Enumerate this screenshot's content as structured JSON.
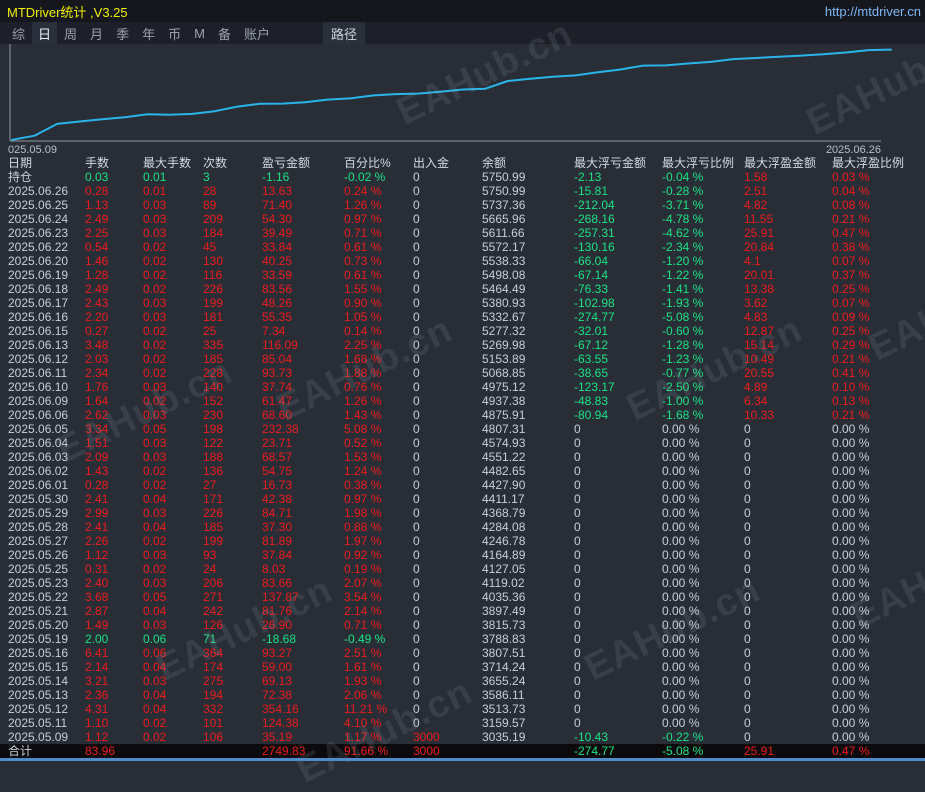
{
  "window": {
    "title": "MTDriver统计 ,V3.25",
    "url": "http://mtdriver.cn"
  },
  "menu": {
    "items": [
      {
        "label": "综",
        "active": false
      },
      {
        "label": "日",
        "active": true
      },
      {
        "label": "周",
        "active": false
      },
      {
        "label": "月",
        "active": false
      },
      {
        "label": "季",
        "active": false
      },
      {
        "label": "年",
        "active": false
      },
      {
        "label": "币",
        "active": false
      },
      {
        "label": "M",
        "active": false
      },
      {
        "label": "备",
        "active": false
      },
      {
        "label": "账户",
        "active": false
      }
    ],
    "path_button": "路径"
  },
  "watermark": {
    "text": "EAHub.cn"
  },
  "colors": {
    "red": "#ee1c1c",
    "green": "#1ce283",
    "text": "#c7cfd8",
    "line": "#29b5ea",
    "title_yellow": "#f0ef00",
    "url_blue": "#7cb8f5"
  },
  "chart_data": {
    "type": "line",
    "title": "账户余额曲线 (equity curve)",
    "x_start_label": "025.05.09",
    "x_end_label": "2025.06.26",
    "ylim": [
      3000,
      5800
    ],
    "line_color": "#29b5ea",
    "grid": false,
    "dates": [
      "2025.05.09",
      "2025.05.11",
      "2025.05.12",
      "2025.05.13",
      "2025.05.14",
      "2025.05.15",
      "2025.05.16",
      "2025.05.19",
      "2025.05.20",
      "2025.05.21",
      "2025.05.22",
      "2025.05.23",
      "2025.05.25",
      "2025.05.26",
      "2025.05.27",
      "2025.05.28",
      "2025.05.29",
      "2025.05.30",
      "2025.06.01",
      "2025.06.02",
      "2025.06.03",
      "2025.06.04",
      "2025.06.05",
      "2025.06.06",
      "2025.06.09",
      "2025.06.10",
      "2025.06.11",
      "2025.06.12",
      "2025.06.13",
      "2025.06.15",
      "2025.06.16",
      "2025.06.17",
      "2025.06.18",
      "2025.06.19",
      "2025.06.20",
      "2025.06.22",
      "2025.06.23",
      "2025.06.24",
      "2025.06.25",
      "2025.06.26"
    ],
    "balances": [
      3035.19,
      3159.57,
      3513.73,
      3586.11,
      3655.24,
      3714.24,
      3807.51,
      3788.83,
      3815.73,
      3897.49,
      4035.36,
      4119.02,
      4127.05,
      4164.89,
      4246.78,
      4284.08,
      4368.79,
      4411.17,
      4427.9,
      4482.65,
      4551.22,
      4574.93,
      4807.31,
      4875.91,
      4937.38,
      4975.12,
      5068.85,
      5153.89,
      5269.98,
      5277.32,
      5332.67,
      5380.93,
      5464.49,
      5498.08,
      5538.33,
      5572.17,
      5611.66,
      5665.96,
      5737.36,
      5750.99
    ]
  },
  "table": {
    "headers": [
      "日期",
      "手数",
      "最大手数",
      "次数",
      "盈亏金额",
      "百分比%",
      "出入金",
      "余额",
      "最大浮亏金额",
      "最大浮亏比例",
      "最大浮盈金额",
      "最大浮盈比例"
    ],
    "rows": [
      [
        "持仓",
        "0.03",
        "0.01",
        "3",
        "-1.16",
        "-0.02 %",
        "0",
        "5750.99",
        "-2.13",
        "-0.04 %",
        "1.58",
        "0.03 %"
      ],
      [
        "2025.06.26",
        "0.28",
        "0.01",
        "28",
        "13.63",
        "0.24 %",
        "0",
        "5750.99",
        "-15.81",
        "-0.28 %",
        "2.51",
        "0.04 %"
      ],
      [
        "2025.06.25",
        "1.13",
        "0.03",
        "89",
        "71.40",
        "1.26 %",
        "0",
        "5737.36",
        "-212.04",
        "-3.71 %",
        "4.82",
        "0.08 %"
      ],
      [
        "2025.06.24",
        "2.49",
        "0.03",
        "209",
        "54.30",
        "0.97 %",
        "0",
        "5665.96",
        "-268.16",
        "-4.78 %",
        "11.55",
        "0.21 %"
      ],
      [
        "2025.06.23",
        "2.25",
        "0.03",
        "184",
        "39.49",
        "0.71 %",
        "0",
        "5611.66",
        "-257.31",
        "-4.62 %",
        "25.91",
        "0.47 %"
      ],
      [
        "2025.06.22",
        "0.54",
        "0.02",
        "45",
        "33.84",
        "0.61 %",
        "0",
        "5572.17",
        "-130.16",
        "-2.34 %",
        "20.84",
        "0.38 %"
      ],
      [
        "2025.06.20",
        "1.46",
        "0.02",
        "130",
        "40.25",
        "0.73 %",
        "0",
        "5538.33",
        "-66.04",
        "-1.20 %",
        "4.1",
        "0.07 %"
      ],
      [
        "2025.06.19",
        "1.28",
        "0.02",
        "116",
        "33.59",
        "0.61 %",
        "0",
        "5498.08",
        "-67.14",
        "-1.22 %",
        "20.01",
        "0.37 %"
      ],
      [
        "2025.06.18",
        "2.49",
        "0.02",
        "226",
        "83.56",
        "1.55 %",
        "0",
        "5464.49",
        "-76.33",
        "-1.41 %",
        "13.38",
        "0.25 %"
      ],
      [
        "2025.06.17",
        "2.43",
        "0.03",
        "199",
        "48.26",
        "0.90 %",
        "0",
        "5380.93",
        "-102.98",
        "-1.93 %",
        "3.62",
        "0.07 %"
      ],
      [
        "2025.06.16",
        "2.20",
        "0.03",
        "181",
        "55.35",
        "1.05 %",
        "0",
        "5332.67",
        "-274.77",
        "-5.08 %",
        "4.83",
        "0.09 %"
      ],
      [
        "2025.06.15",
        "0.27",
        "0.02",
        "25",
        "7.34",
        "0.14 %",
        "0",
        "5277.32",
        "-32.01",
        "-0.60 %",
        "12.87",
        "0.25 %"
      ],
      [
        "2025.06.13",
        "3.48",
        "0.02",
        "335",
        "116.09",
        "2.25 %",
        "0",
        "5269.98",
        "-67.12",
        "-1.28 %",
        "15.14",
        "0.29 %"
      ],
      [
        "2025.06.12",
        "2.03",
        "0.02",
        "185",
        "85.04",
        "1.68 %",
        "0",
        "5153.89",
        "-63.55",
        "-1.23 %",
        "10.49",
        "0.21 %"
      ],
      [
        "2025.06.11",
        "2.34",
        "0.02",
        "228",
        "93.73",
        "1.88 %",
        "0",
        "5068.85",
        "-38.65",
        "-0.77 %",
        "20.55",
        "0.41 %"
      ],
      [
        "2025.06.10",
        "1.76",
        "0.03",
        "140",
        "37.74",
        "0.76 %",
        "0",
        "4975.12",
        "-123.17",
        "-2.50 %",
        "4.89",
        "0.10 %"
      ],
      [
        "2025.06.09",
        "1.64",
        "0.02",
        "152",
        "61.47",
        "1.26 %",
        "0",
        "4937.38",
        "-48.83",
        "-1.00 %",
        "6.34",
        "0.13 %"
      ],
      [
        "2025.06.06",
        "2.62",
        "0.03",
        "230",
        "68.60",
        "1.43 %",
        "0",
        "4875.91",
        "-80.94",
        "-1.68 %",
        "10.33",
        "0.21 %"
      ],
      [
        "2025.06.05",
        "3.34",
        "0.05",
        "198",
        "232.38",
        "5.08 %",
        "0",
        "4807.31",
        "0",
        "0.00 %",
        "0",
        "0.00 %"
      ],
      [
        "2025.06.04",
        "1.51",
        "0.03",
        "122",
        "23.71",
        "0.52 %",
        "0",
        "4574.93",
        "0",
        "0.00 %",
        "0",
        "0.00 %"
      ],
      [
        "2025.06.03",
        "2.09",
        "0.03",
        "188",
        "68.57",
        "1.53 %",
        "0",
        "4551.22",
        "0",
        "0.00 %",
        "0",
        "0.00 %"
      ],
      [
        "2025.06.02",
        "1.43",
        "0.02",
        "136",
        "54.75",
        "1.24 %",
        "0",
        "4482.65",
        "0",
        "0.00 %",
        "0",
        "0.00 %"
      ],
      [
        "2025.06.01",
        "0.28",
        "0.02",
        "27",
        "16.73",
        "0.38 %",
        "0",
        "4427.90",
        "0",
        "0.00 %",
        "0",
        "0.00 %"
      ],
      [
        "2025.05.30",
        "2.41",
        "0.04",
        "171",
        "42.38",
        "0.97 %",
        "0",
        "4411.17",
        "0",
        "0.00 %",
        "0",
        "0.00 %"
      ],
      [
        "2025.05.29",
        "2.99",
        "0.03",
        "226",
        "84.71",
        "1.98 %",
        "0",
        "4368.79",
        "0",
        "0.00 %",
        "0",
        "0.00 %"
      ],
      [
        "2025.05.28",
        "2.41",
        "0.04",
        "185",
        "37.30",
        "0.88 %",
        "0",
        "4284.08",
        "0",
        "0.00 %",
        "0",
        "0.00 %"
      ],
      [
        "2025.05.27",
        "2.26",
        "0.02",
        "199",
        "81.89",
        "1.97 %",
        "0",
        "4246.78",
        "0",
        "0.00 %",
        "0",
        "0.00 %"
      ],
      [
        "2025.05.26",
        "1.12",
        "0.03",
        "93",
        "37.84",
        "0.92 %",
        "0",
        "4164.89",
        "0",
        "0.00 %",
        "0",
        "0.00 %"
      ],
      [
        "2025.05.25",
        "0.31",
        "0.02",
        "24",
        "8.03",
        "0.19 %",
        "0",
        "4127.05",
        "0",
        "0.00 %",
        "0",
        "0.00 %"
      ],
      [
        "2025.05.23",
        "2.40",
        "0.03",
        "206",
        "83.66",
        "2.07 %",
        "0",
        "4119.02",
        "0",
        "0.00 %",
        "0",
        "0.00 %"
      ],
      [
        "2025.05.22",
        "3.68",
        "0.05",
        "271",
        "137.87",
        "3.54 %",
        "0",
        "4035.36",
        "0",
        "0.00 %",
        "0",
        "0.00 %"
      ],
      [
        "2025.05.21",
        "2.87",
        "0.04",
        "242",
        "81.76",
        "2.14 %",
        "0",
        "3897.49",
        "0",
        "0.00 %",
        "0",
        "0.00 %"
      ],
      [
        "2025.05.20",
        "1.49",
        "0.03",
        "126",
        "26.90",
        "0.71 %",
        "0",
        "3815.73",
        "0",
        "0.00 %",
        "0",
        "0.00 %"
      ],
      [
        "2025.05.19",
        "2.00",
        "0.06",
        "71",
        "-18.68",
        "-0.49 %",
        "0",
        "3788.83",
        "0",
        "0.00 %",
        "0",
        "0.00 %"
      ],
      [
        "2025.05.16",
        "6.41",
        "0.06",
        "364",
        "93.27",
        "2.51 %",
        "0",
        "3807.51",
        "0",
        "0.00 %",
        "0",
        "0.00 %"
      ],
      [
        "2025.05.15",
        "2.14",
        "0.04",
        "174",
        "59.00",
        "1.61 %",
        "0",
        "3714.24",
        "0",
        "0.00 %",
        "0",
        "0.00 %"
      ],
      [
        "2025.05.14",
        "3.21",
        "0.03",
        "275",
        "69.13",
        "1.93 %",
        "0",
        "3655.24",
        "0",
        "0.00 %",
        "0",
        "0.00 %"
      ],
      [
        "2025.05.13",
        "2.36",
        "0.04",
        "194",
        "72.38",
        "2.06 %",
        "0",
        "3586.11",
        "0",
        "0.00 %",
        "0",
        "0.00 %"
      ],
      [
        "2025.05.12",
        "4.31",
        "0.04",
        "332",
        "354.16",
        "11.21 %",
        "0",
        "3513.73",
        "0",
        "0.00 %",
        "0",
        "0.00 %"
      ],
      [
        "2025.05.11",
        "1.10",
        "0.02",
        "101",
        "124.38",
        "4.10 %",
        "0",
        "3159.57",
        "0",
        "0.00 %",
        "0",
        "0.00 %"
      ],
      [
        "2025.05.09",
        "1.12",
        "0.02",
        "106",
        "35.19",
        "1.17 %",
        "3000",
        "3035.19",
        "-10.43",
        "-0.22 %",
        "0",
        "0.00 %"
      ]
    ],
    "total_row": [
      "合计",
      "83.96",
      "",
      "",
      "2749.83",
      "91.66 %",
      "3000",
      "",
      "-274.77",
      "-5.08 %",
      "25.91",
      "0.47 %"
    ]
  }
}
